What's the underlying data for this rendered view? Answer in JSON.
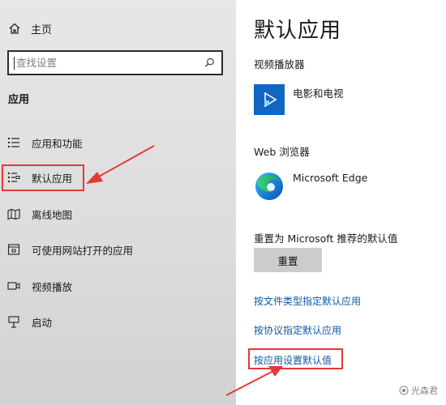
{
  "sidebar": {
    "home_label": "主页",
    "search_placeholder": "查找设置",
    "section_title": "应用",
    "items": [
      {
        "label": "应用和功能",
        "icon": "apps-features-icon"
      },
      {
        "label": "默认应用",
        "icon": "default-apps-icon"
      },
      {
        "label": "离线地图",
        "icon": "offline-maps-icon"
      },
      {
        "label": "可使用网站打开的应用",
        "icon": "apps-for-websites-icon"
      },
      {
        "label": "视频播放",
        "icon": "video-playback-icon"
      },
      {
        "label": "启动",
        "icon": "startup-icon"
      }
    ]
  },
  "main": {
    "title": "默认应用",
    "video_player_label": "视频播放器",
    "video_app": "电影和电视",
    "browser_label": "Web 浏览器",
    "browser_app": "Microsoft Edge",
    "reset_label": "重置为 Microsoft 推荐的默认值",
    "reset_button": "重置",
    "links": [
      "按文件类型指定默认应用",
      "按协议指定默认应用",
      "按应用设置默认值"
    ]
  },
  "watermark": "光森君",
  "colors": {
    "accent_link": "#0a5aa8",
    "highlight": "#e53935",
    "sidebar_bg": "#e0e0e0",
    "button_bg": "#cccccc"
  }
}
